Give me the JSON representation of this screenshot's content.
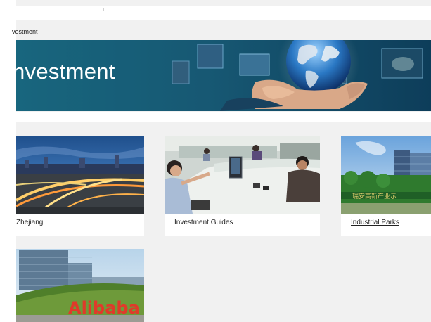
{
  "breadcrumb": {
    "text": "vestment"
  },
  "banner": {
    "title": "nvestment"
  },
  "cards": [
    {
      "caption": "Zhejiang",
      "image": "city-night-highway"
    },
    {
      "caption": "Investment Guides",
      "image": "service-hall-desk"
    },
    {
      "caption": "Industrial Parks",
      "image": "industrial-park-tower"
    },
    {
      "caption": "",
      "image": "alibaba-campus"
    }
  ],
  "colors": {
    "banner_teal": "#1f6b82",
    "page_bg": "#f1f1f1",
    "card_bg": "#ffffff"
  }
}
